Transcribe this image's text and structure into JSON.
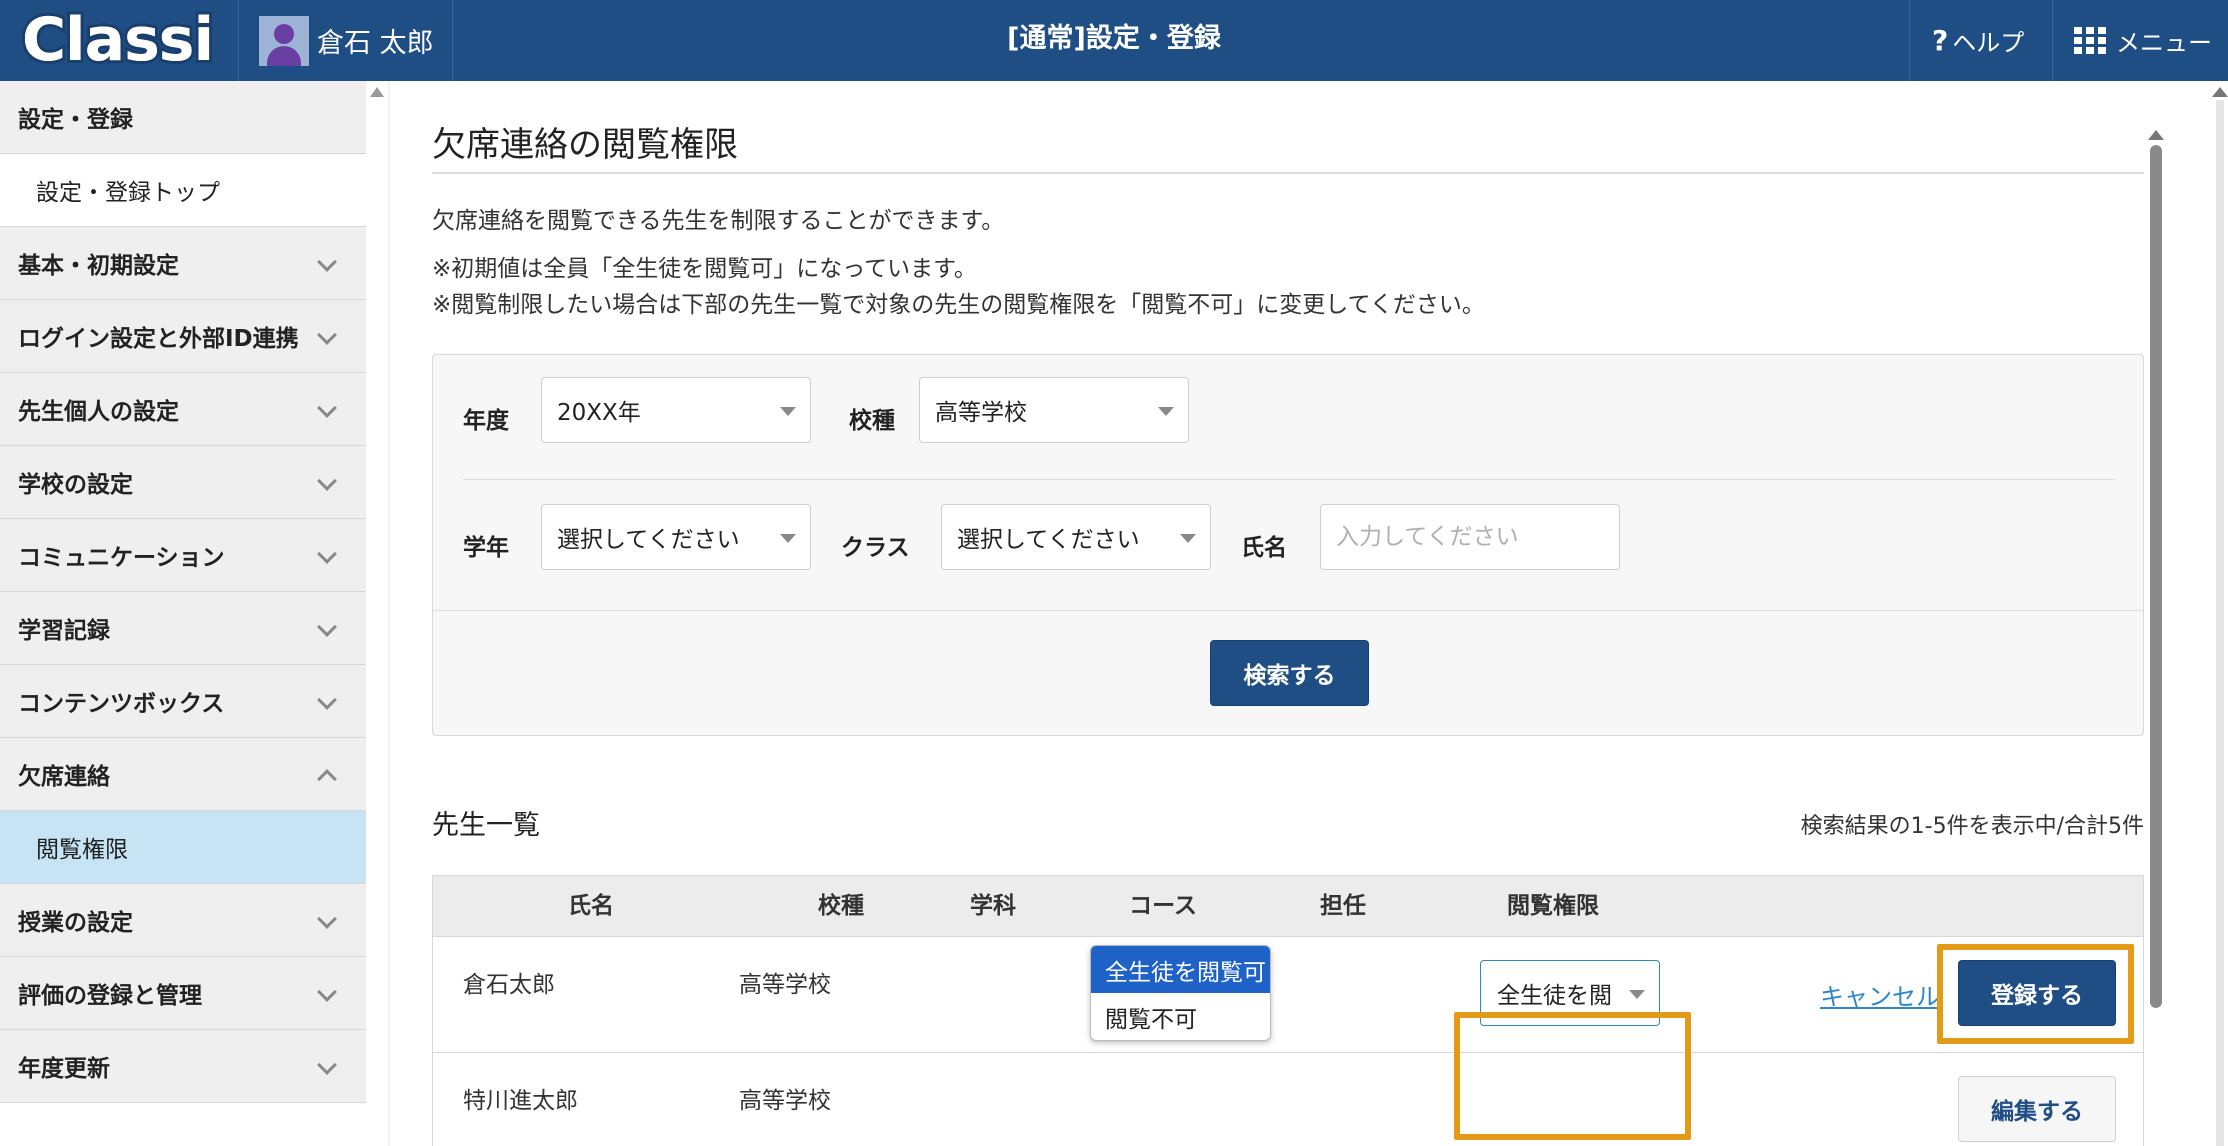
{
  "header": {
    "logo": "Classi",
    "user_name": "倉石 太郎",
    "title": "[通常]設定・登録",
    "help_label": "ヘルプ",
    "menu_label": "メニュー"
  },
  "sidebar": {
    "items": [
      {
        "label": "設定・登録",
        "type": "section"
      },
      {
        "label": "設定・登録トップ",
        "type": "sub"
      },
      {
        "label": "基本・初期設定",
        "type": "group"
      },
      {
        "label": "ログイン設定と外部ID連携",
        "type": "group"
      },
      {
        "label": "先生個人の設定",
        "type": "group"
      },
      {
        "label": "学校の設定",
        "type": "group"
      },
      {
        "label": "コミュニケーション",
        "type": "group"
      },
      {
        "label": "学習記録",
        "type": "group"
      },
      {
        "label": "コンテンツボックス",
        "type": "group"
      },
      {
        "label": "欠席連絡",
        "type": "group-open"
      },
      {
        "label": "閲覧権限",
        "type": "sub-active"
      },
      {
        "label": "授業の設定",
        "type": "group"
      },
      {
        "label": "評価の登録と管理",
        "type": "group"
      },
      {
        "label": "年度更新",
        "type": "group"
      }
    ]
  },
  "main": {
    "title": "欠席連絡の閲覧権限",
    "description": "欠席連絡を閲覧できる先生を制限することができます。",
    "note1": "※初期値は全員「全生徒を閲覧可」になっています。",
    "note2": "※閲覧制限したい場合は下部の先生一覧で対象の先生の閲覧権限を「閲覧不可」に変更してください。",
    "search": {
      "year_label": "年度",
      "year_value": "20XX年",
      "school_type_label": "校種",
      "school_type_value": "高等学校",
      "grade_label": "学年",
      "grade_value": "選択してください",
      "class_label": "クラス",
      "class_value": "選択してください",
      "name_label": "氏名",
      "name_placeholder": "入力してください",
      "submit_label": "検索する"
    },
    "list_title": "先生一覧",
    "result_count": "検索結果の1-5件を表示中/合計5件",
    "table": {
      "headers": [
        "氏名",
        "校種",
        "学科",
        "コース",
        "担任",
        "閲覧権限"
      ],
      "rows": [
        {
          "name": "倉石太郎",
          "school_type": "高等学校",
          "permission": "全生徒を閲",
          "cancel_label": "キャンセル",
          "action_label": "登録する"
        },
        {
          "name": "特川進太郎",
          "school_type": "高等学校",
          "action_label": "編集する"
        }
      ]
    },
    "permission_dropdown": {
      "options": [
        "全生徒を閲覧可",
        "閲覧不可"
      ],
      "selected_index": 0
    }
  },
  "colors": {
    "header_bg": "#1f4e85",
    "primary_button": "#1f4e85",
    "sidebar_active": "#c6e4f3",
    "highlight": "#e39a16",
    "dropdown_selected": "#1e62c8",
    "link": "#2f86c9"
  }
}
